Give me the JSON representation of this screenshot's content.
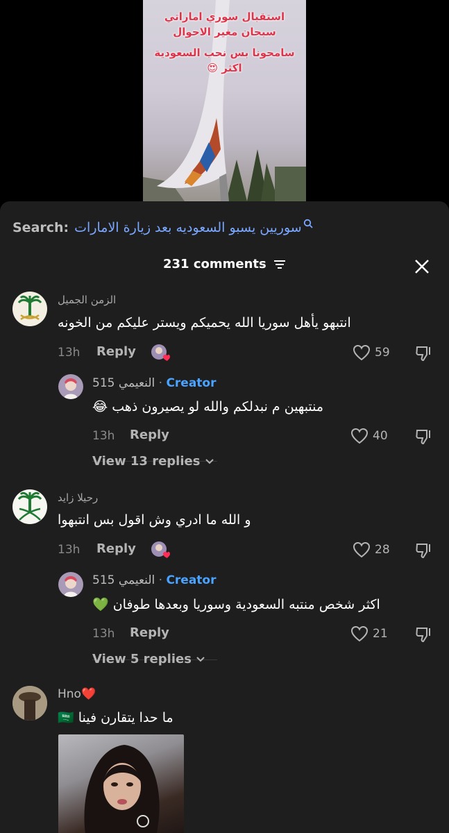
{
  "video": {
    "overlay_lines": [
      "استقبال سوري اماراتي",
      "سبحان مغير الاحوال",
      "سامحونا بس نحب السعودية",
      "اكثر 😍"
    ]
  },
  "search": {
    "label": "Search:",
    "query": "سوريين يسبو السعوديه بعد زيارة الامارات"
  },
  "comments_header": {
    "count_label": "231 comments"
  },
  "comments": [
    {
      "username": "الزمن الجميل",
      "text": "انتبهو يأهل سوريا الله يحميكم ويستر عليكم من الخونه",
      "time": "13h",
      "reply_label": "Reply",
      "likes": "59",
      "reply": {
        "username": "النعيمي 515",
        "creator_label": "Creator",
        "text": "منتبهين م نبدلكم والله لو يصيرون ذهب 😂",
        "time": "13h",
        "reply_label": "Reply",
        "likes": "40"
      },
      "view_replies": "View 13 replies"
    },
    {
      "username": "رحيلا زايد",
      "text": "و الله ما ادري وش اقول بس انتبهوا",
      "time": "13h",
      "reply_label": "Reply",
      "likes": "28",
      "reply": {
        "username": "النعيمي 515",
        "creator_label": "Creator",
        "text": "اكثر شخص منتبه السعودية وسوريا وبعدها طوفان 💚",
        "time": "13h",
        "reply_label": "Reply",
        "likes": "21"
      },
      "view_replies": "View 5 replies"
    },
    {
      "username": "Hno❤️",
      "text": "ما حدا يتقارن فينا 🇸🇦"
    }
  ],
  "colors": {
    "sheet_bg": "#1e1e1e",
    "creator_blue": "#4aa3ff",
    "search_query": "#7aa7ff",
    "overlay_red": "#e0334a"
  }
}
